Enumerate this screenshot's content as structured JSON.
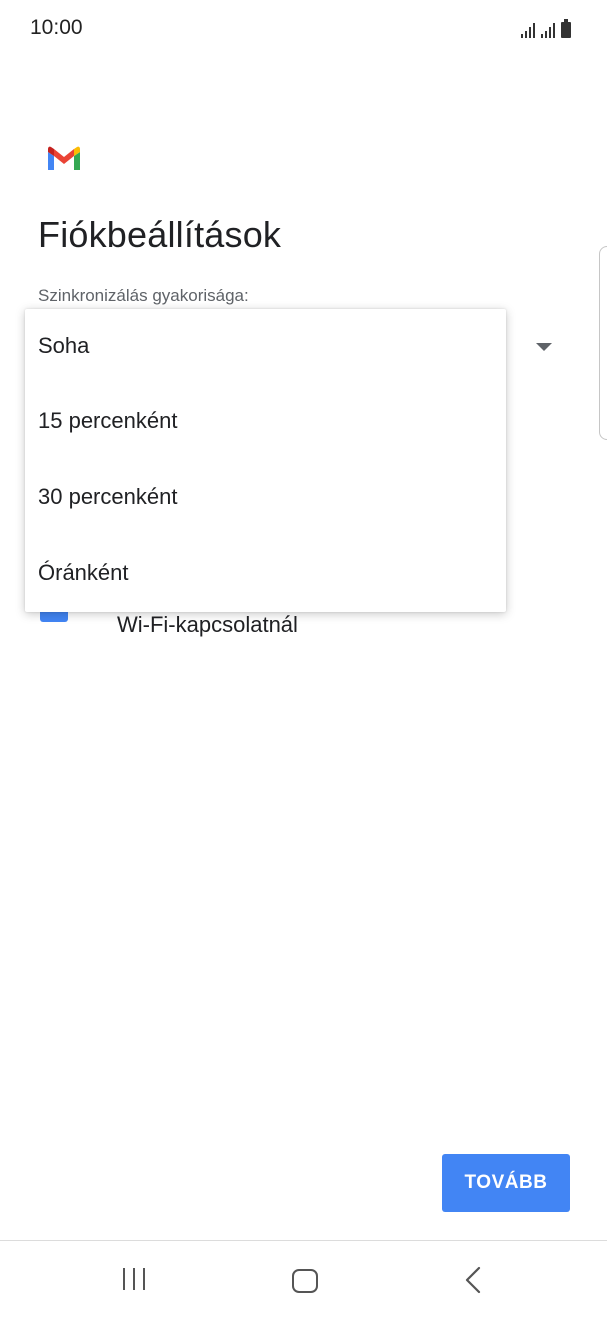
{
  "status_bar": {
    "time": "10:00",
    "icons": [
      "signal-1-icon",
      "signal-2-icon",
      "battery-icon"
    ]
  },
  "app": {
    "logo": "gmail-logo-icon",
    "brand_colors": [
      "#ea4335",
      "#4285f4",
      "#34a853",
      "#fbbc04",
      "#c5221f"
    ]
  },
  "page": {
    "title": "Fiókbeállítások"
  },
  "sync": {
    "label": "Szinkronizálás gyakorisága:",
    "options": [
      "Soha",
      "15 percenként",
      "30 percenként",
      "Óránként"
    ]
  },
  "wifi_checkbox": {
    "label": "Wi-Fi-kapcsolatnál",
    "checked": true
  },
  "actions": {
    "next_label": "TOVÁBB"
  },
  "colors": {
    "accent": "#4285f4",
    "text_primary": "#202124",
    "text_secondary": "#5f6368"
  },
  "nav_bar": {
    "icons": [
      "recents-icon",
      "home-icon",
      "back-icon"
    ]
  }
}
